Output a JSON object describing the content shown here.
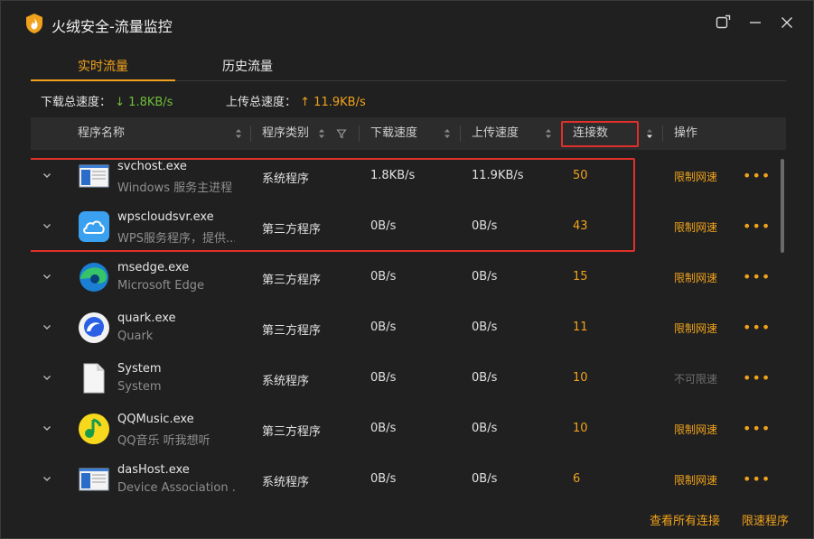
{
  "window": {
    "title": "火绒安全-流量监控",
    "controls": [
      "restore-icon",
      "minimize-icon",
      "close-icon"
    ]
  },
  "tabs": [
    {
      "label": "实时流量",
      "active": true
    },
    {
      "label": "历史流量",
      "active": false
    }
  ],
  "summary": {
    "download_label": "下载总速度：",
    "download_value": "↓ 1.8KB/s",
    "upload_label": "上传总速度：",
    "upload_value": "↑ 11.9KB/s"
  },
  "columns": {
    "name": "程序名称",
    "category": "程序类别",
    "download": "下载速度",
    "upload": "上传速度",
    "connections": "连接数",
    "action": "操作"
  },
  "rows": [
    {
      "name": "svchost.exe",
      "desc": "Windows 服务主进程",
      "category": "系统程序",
      "download": "1.8KB/s",
      "upload": "11.9KB/s",
      "connections": "50",
      "action": "限制网速",
      "action_enabled": true,
      "icon": "window-icon"
    },
    {
      "name": "wpscloudsvr.exe",
      "desc": "WPS服务程序，提供...",
      "category": "第三方程序",
      "download": "0B/s",
      "upload": "0B/s",
      "connections": "43",
      "action": "限制网速",
      "action_enabled": true,
      "icon": "cloud-icon"
    },
    {
      "name": "msedge.exe",
      "desc": "Microsoft Edge",
      "category": "第三方程序",
      "download": "0B/s",
      "upload": "0B/s",
      "connections": "15",
      "action": "限制网速",
      "action_enabled": true,
      "icon": "edge-icon"
    },
    {
      "name": "quark.exe",
      "desc": "Quark",
      "category": "第三方程序",
      "download": "0B/s",
      "upload": "0B/s",
      "connections": "11",
      "action": "限制网速",
      "action_enabled": true,
      "icon": "quark-icon"
    },
    {
      "name": "System",
      "desc": "System",
      "category": "系统程序",
      "download": "0B/s",
      "upload": "0B/s",
      "connections": "10",
      "action": "不可限速",
      "action_enabled": false,
      "icon": "file-icon"
    },
    {
      "name": "QQMusic.exe",
      "desc": "QQ音乐 听我想听",
      "category": "第三方程序",
      "download": "0B/s",
      "upload": "0B/s",
      "connections": "10",
      "action": "限制网速",
      "action_enabled": true,
      "icon": "qqmusic-icon"
    },
    {
      "name": "dasHost.exe",
      "desc": "Device Association ...",
      "category": "系统程序",
      "download": "0B/s",
      "upload": "0B/s",
      "connections": "6",
      "action": "限制网速",
      "action_enabled": true,
      "icon": "window-icon"
    }
  ],
  "more_label": "•••",
  "footer": {
    "view_all": "查看所有连接",
    "limited": "限速程序"
  },
  "colors": {
    "accent": "#f0a21c",
    "download_green": "#6fbf3a",
    "highlight_red": "#e0302a",
    "background": "#202020"
  }
}
